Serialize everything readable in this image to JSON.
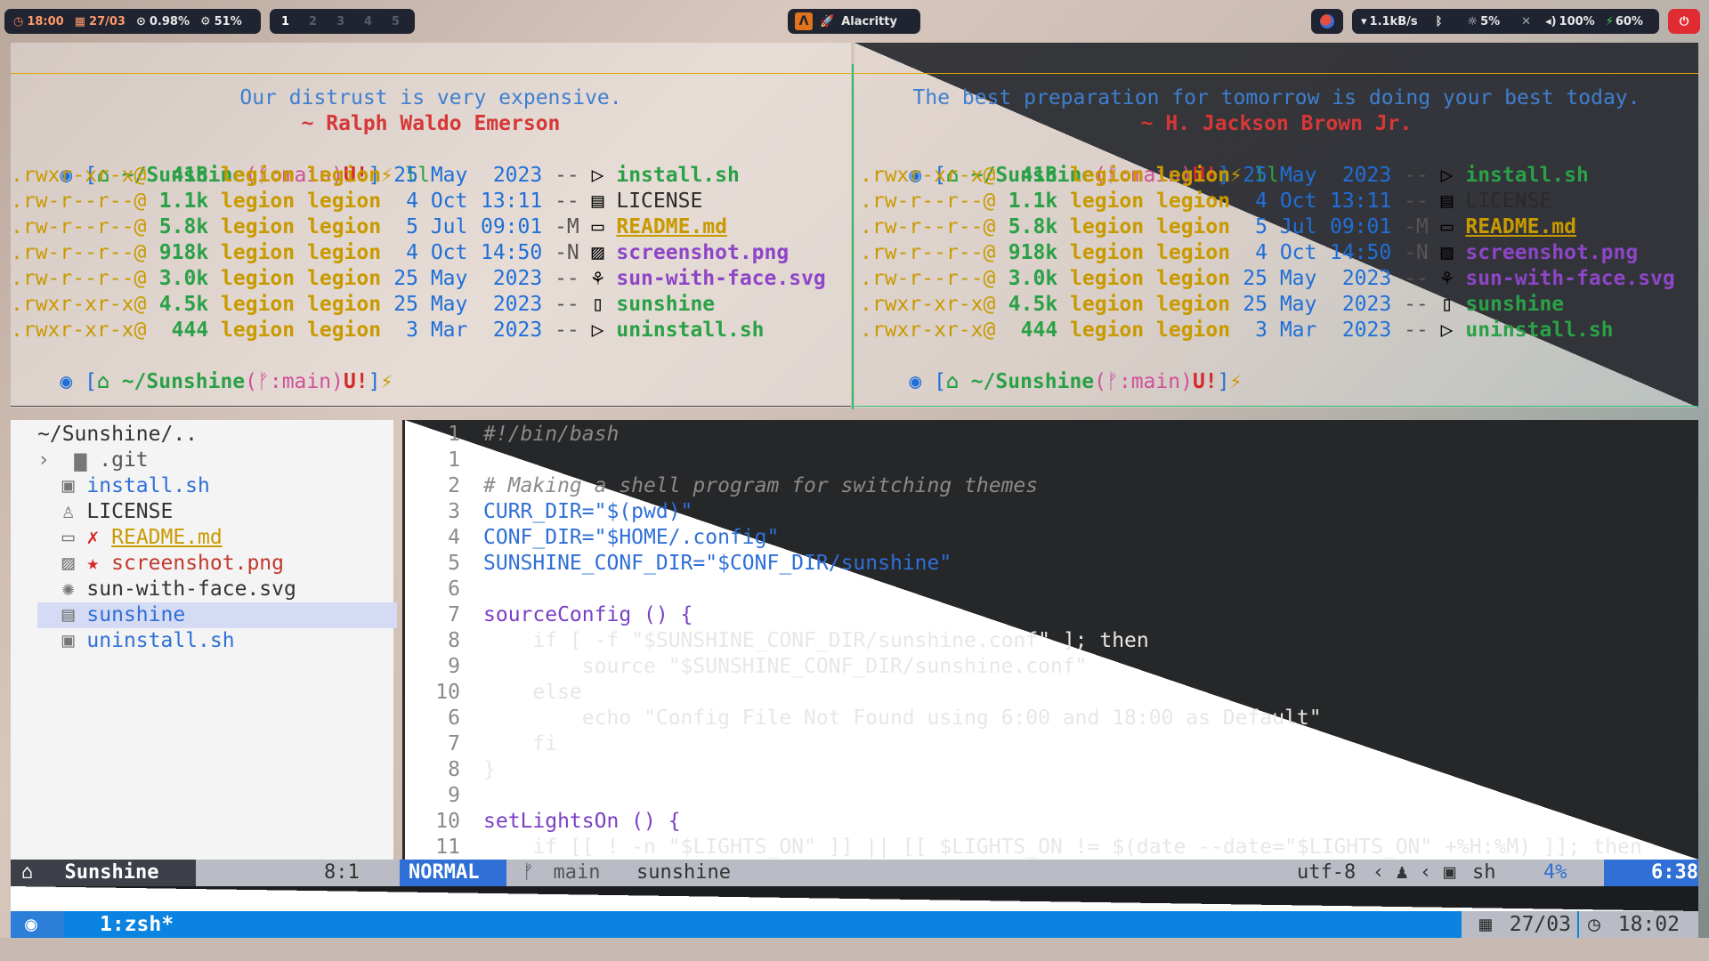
{
  "topbar": {
    "time": "18:00",
    "date": "27/03",
    "cpu": "0.98%",
    "mem": "51%",
    "workspaces": [
      "1",
      "2",
      "3",
      "4",
      "5"
    ],
    "active_workspace": "1",
    "window_title": "Alacritty",
    "net": "1.1kB/s",
    "brightness": "5%",
    "volume": "100%",
    "battery": "60%"
  },
  "terminal_left": {
    "quote": "Our distrust is very expensive.",
    "author": "~ Ralph Waldo Emerson",
    "prompt_dir": "~/Sunshine",
    "prompt_branch": "main",
    "prompt_flags": "U!",
    "command": "ll"
  },
  "terminal_right": {
    "quote": "The best preparation for tomorrow is doing your best today.",
    "author": "~ H. Jackson Brown Jr.",
    "prompt_dir": "~/Sunshine",
    "prompt_branch": "main",
    "prompt_flags": "U!",
    "command": "ll"
  },
  "listing": [
    {
      "perms": ".rwxr-xr-x@",
      "size": "418",
      "user": "legion",
      "group": "legion",
      "day": "25",
      "month": "May",
      "time": "2023",
      "git": "--",
      "name": "install.sh",
      "kind": "sh"
    },
    {
      "perms": ".rw-r--r--@",
      "size": "1.1k",
      "user": "legion",
      "group": "legion",
      "day": "4",
      "month": "Oct",
      "time": "13:11",
      "git": "--",
      "name": "LICENSE",
      "kind": "lic"
    },
    {
      "perms": ".rw-r--r--@",
      "size": "5.8k",
      "user": "legion",
      "group": "legion",
      "day": "5",
      "month": "Jul",
      "time": "09:01",
      "git": "-M",
      "name": "README.md",
      "kind": "md"
    },
    {
      "perms": ".rw-r--r--@",
      "size": "918k",
      "user": "legion",
      "group": "legion",
      "day": "4",
      "month": "Oct",
      "time": "14:50",
      "git": "-N",
      "name": "screenshot.png",
      "kind": "png"
    },
    {
      "perms": ".rw-r--r--@",
      "size": "3.0k",
      "user": "legion",
      "group": "legion",
      "day": "25",
      "month": "May",
      "time": "2023",
      "git": "--",
      "name": "sun-with-face.svg",
      "kind": "svg"
    },
    {
      "perms": ".rwxr-xr-x@",
      "size": "4.5k",
      "user": "legion",
      "group": "legion",
      "day": "25",
      "month": "May",
      "time": "2023",
      "git": "--",
      "name": "sunshine",
      "kind": "plain"
    },
    {
      "perms": ".rwxr-xr-x@",
      "size": "444",
      "user": "legion",
      "group": "legion",
      "day": "3",
      "month": "Mar",
      "time": "2023",
      "git": "--",
      "name": "uninstall.sh",
      "kind": "sh"
    }
  ],
  "tree": {
    "root": "~/Sunshine/..",
    "items": [
      {
        "label": ".git",
        "marker": ""
      },
      {
        "label": "install.sh",
        "marker": ""
      },
      {
        "label": "LICENSE",
        "marker": ""
      },
      {
        "label": "README.md",
        "marker": "✗"
      },
      {
        "label": "screenshot.png",
        "marker": "★"
      },
      {
        "label": "sun-with-face.svg",
        "marker": ""
      },
      {
        "label": "sunshine",
        "marker": ""
      },
      {
        "label": "uninstall.sh",
        "marker": ""
      }
    ]
  },
  "code_lines": [
    {
      "n": "1",
      "text": "#!/bin/bash"
    },
    {
      "n": "1",
      "text": ""
    },
    {
      "n": "2",
      "text": "# Making a shell program for switching themes"
    },
    {
      "n": "3",
      "text": "CURR_DIR=\"$(pwd)\""
    },
    {
      "n": "4",
      "text": "CONF_DIR=\"$HOME/.config\""
    },
    {
      "n": "5",
      "text": "SUNSHINE_CONF_DIR=\"$CONF_DIR/sunshine\""
    },
    {
      "n": "6",
      "text": ""
    },
    {
      "n": "7",
      "text": "sourceConfig () {"
    },
    {
      "n": "8",
      "text": "    if [ -f \"$SUNSHINE_CONF_DIR/sunshine.conf\" ]; then"
    },
    {
      "n": "9",
      "text": "        source \"$SUNSHINE_CONF_DIR/sunshine.conf\""
    },
    {
      "n": "10",
      "text": "    else"
    },
    {
      "n": "6",
      "text": "        echo \"Config File Not Found using 6:00 and 18:00 as Default\""
    },
    {
      "n": "7",
      "text": "    fi"
    },
    {
      "n": "8",
      "text": "}"
    },
    {
      "n": "9",
      "text": ""
    },
    {
      "n": "10",
      "text": "setLightsOn () {"
    },
    {
      "n": "11",
      "text": "    if [[ ! -n \"$LIGHTS_ON\" ]] || [[ $LIGHTS_ON != $(date --date=\"$LIGHTS_ON\" +%H:%M) ]]; then"
    }
  ],
  "statusline": {
    "tree_name": "Sunshine",
    "tree_pos": "8:1",
    "mode": "NORMAL",
    "branch": "main",
    "file": "sunshine",
    "encoding": "utf-8",
    "filetype": "sh",
    "percent": "4%",
    "position": "6:38"
  },
  "tmux": {
    "window": "1:zsh*",
    "date": "27/03",
    "time": "18:02"
  },
  "colors": {
    "accent": "#0a84e0",
    "mode_bg": "#2f6fd6"
  }
}
